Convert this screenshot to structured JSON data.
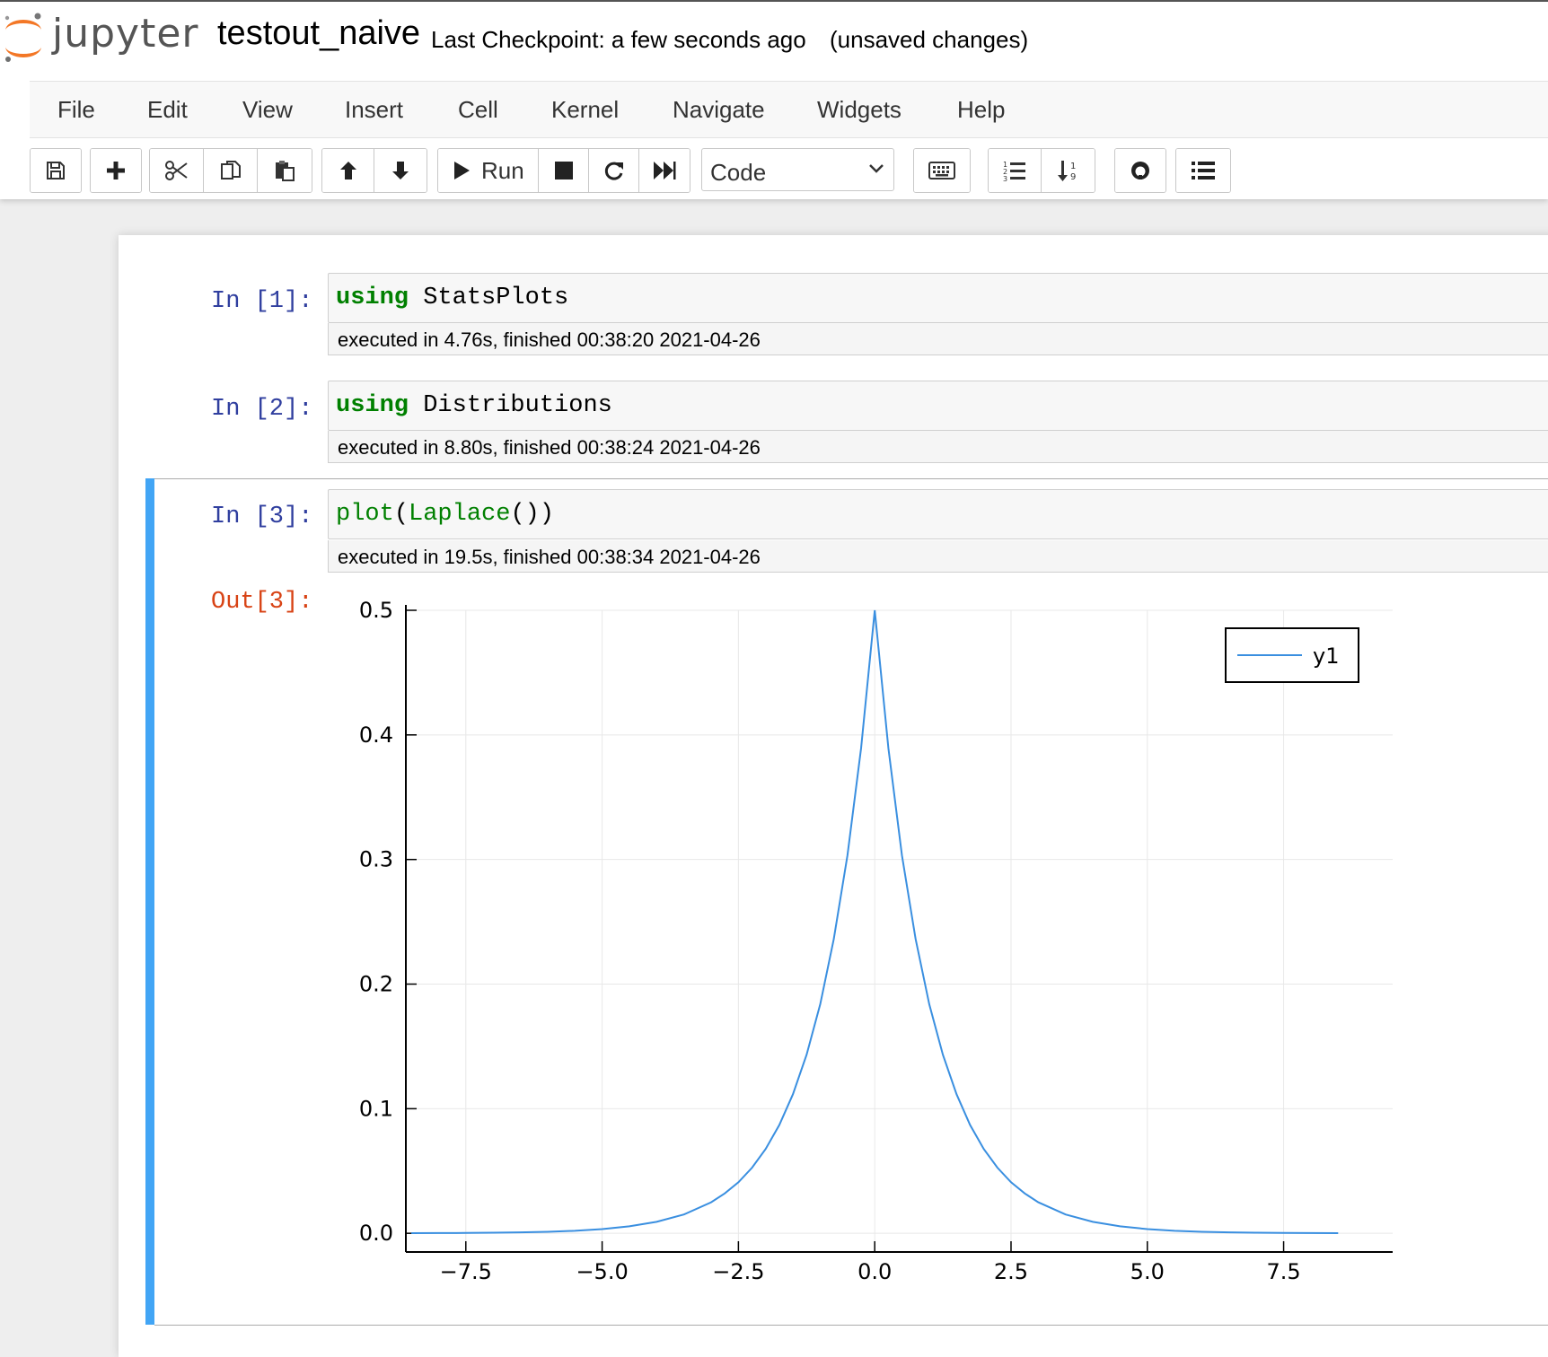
{
  "header": {
    "logo_text": "jupyter",
    "notebook_name": "testout_naive",
    "checkpoint": "Last Checkpoint: a few seconds ago",
    "unsaved": "(unsaved changes)"
  },
  "menu": {
    "items": [
      "File",
      "Edit",
      "View",
      "Insert",
      "Cell",
      "Kernel",
      "Navigate",
      "Widgets",
      "Help"
    ]
  },
  "toolbar": {
    "run_label": "Run",
    "cell_type": "Code",
    "icons": [
      "save-icon",
      "plus-icon",
      "cut-icon",
      "copy-icon",
      "paste-icon",
      "arrow-up-icon",
      "arrow-down-icon",
      "play-icon",
      "stop-icon",
      "restart-icon",
      "fast-forward-icon",
      "keyboard-icon",
      "numbered-list-icon",
      "sort-numeric-icon",
      "github-icon",
      "list-icon"
    ]
  },
  "cells": [
    {
      "prompt": "In [1]:",
      "code_keyword": "using",
      "code_rest": "StatsPlots",
      "exec_info": "executed in 4.76s, finished 00:38:20 2021-04-26"
    },
    {
      "prompt": "In [2]:",
      "code_keyword": "using",
      "code_rest": "Distributions",
      "exec_info": "executed in 8.80s, finished 00:38:24 2021-04-26"
    },
    {
      "prompt": "In [3]:",
      "code_fn": "plot",
      "code_p1": "(",
      "code_fn2": "Laplace",
      "code_p2": "())",
      "exec_info": "executed in 19.5s, finished 00:38:34 2021-04-26",
      "out_prompt": "Out[3]:"
    }
  ],
  "colors": {
    "in_prompt": "#303f9f",
    "out_prompt": "#d84315",
    "code_keyword": "#008000",
    "selection_bar": "#42a5f5",
    "line": "#3a8fe0"
  },
  "chart_data": {
    "type": "line",
    "title": "",
    "xlabel": "",
    "ylabel": "",
    "xlim": [
      -8.6,
      9.5
    ],
    "ylim": [
      -0.015,
      0.5
    ],
    "x_ticks": [
      -7.5,
      -5.0,
      -2.5,
      0.0,
      2.5,
      5.0,
      7.5
    ],
    "x_tick_labels": [
      "−7.5",
      "−5.0",
      "−2.5",
      "0.0",
      "2.5",
      "5.0",
      "7.5"
    ],
    "y_ticks": [
      0.0,
      0.1,
      0.2,
      0.3,
      0.4,
      0.5
    ],
    "y_tick_labels": [
      "0.0",
      "0.1",
      "0.2",
      "0.3",
      "0.4",
      "0.5"
    ],
    "grid": true,
    "legend_position": "top-right",
    "series": [
      {
        "name": "y1",
        "x": [
          -8.5,
          -8.0,
          -7.5,
          -7.0,
          -6.5,
          -6.0,
          -5.5,
          -5.0,
          -4.5,
          -4.0,
          -3.5,
          -3.0,
          -2.75,
          -2.5,
          -2.25,
          -2.0,
          -1.75,
          -1.5,
          -1.25,
          -1.0,
          -0.75,
          -0.5,
          -0.25,
          0.0,
          0.25,
          0.5,
          0.75,
          1.0,
          1.25,
          1.5,
          1.75,
          2.0,
          2.25,
          2.5,
          2.75,
          3.0,
          3.5,
          4.0,
          4.5,
          5.0,
          5.5,
          6.0,
          6.5,
          7.0,
          7.5,
          8.0,
          8.5
        ],
        "y": [
          0.0001,
          0.0002,
          0.0003,
          0.0005,
          0.0008,
          0.0012,
          0.002,
          0.0034,
          0.0056,
          0.0092,
          0.0151,
          0.0249,
          0.032,
          0.041,
          0.0527,
          0.0677,
          0.0869,
          0.1116,
          0.1433,
          0.1839,
          0.2362,
          0.3033,
          0.3894,
          0.5,
          0.3894,
          0.3033,
          0.2362,
          0.1839,
          0.1433,
          0.1116,
          0.0869,
          0.0677,
          0.0527,
          0.041,
          0.032,
          0.0249,
          0.0151,
          0.0092,
          0.0056,
          0.0034,
          0.002,
          0.0012,
          0.0008,
          0.0005,
          0.0003,
          0.0002,
          0.0001
        ]
      }
    ]
  }
}
